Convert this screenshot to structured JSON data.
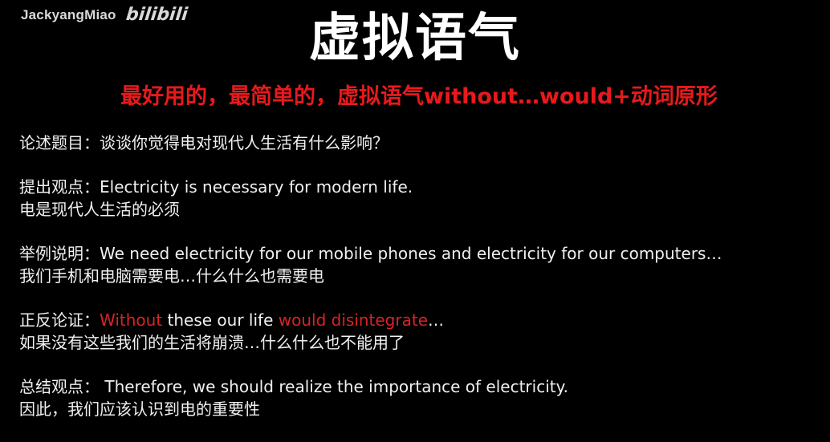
{
  "watermark": {
    "channel": "JackyangMiao",
    "logo": "bilibili"
  },
  "title": "虚拟语气",
  "subtitle": "最好用的，最简单的，虚拟语气without…would+动词原形",
  "colors": {
    "background": "#000000",
    "text": "#f0f0f0",
    "highlight": "#e8191c"
  },
  "sections": [
    {
      "label": "论述题目：",
      "text": "谈谈你觉得电对现代人生活有什么影响？"
    },
    {
      "label": "提出观点：",
      "text": "Electricity is necessary for modern life.",
      "translation": "电是现代人生活的必须"
    },
    {
      "label": "举例说明：",
      "text": "We need electricity for our mobile phones and electricity for our computers…",
      "translation": "我们手机和电脑需要电…什么什么也需要电"
    },
    {
      "label": "正反论证：",
      "part1": "Without",
      "part2": " these our life ",
      "part3": "would disintegrate",
      "part4": "…",
      "translation": "如果没有这些我们的生活将崩溃…什么什么也不能用了"
    },
    {
      "label": "总结观点：",
      "text": " Therefore, we should realize the importance of electricity.",
      "translation": "因此，我们应该认识到电的重要性"
    }
  ]
}
